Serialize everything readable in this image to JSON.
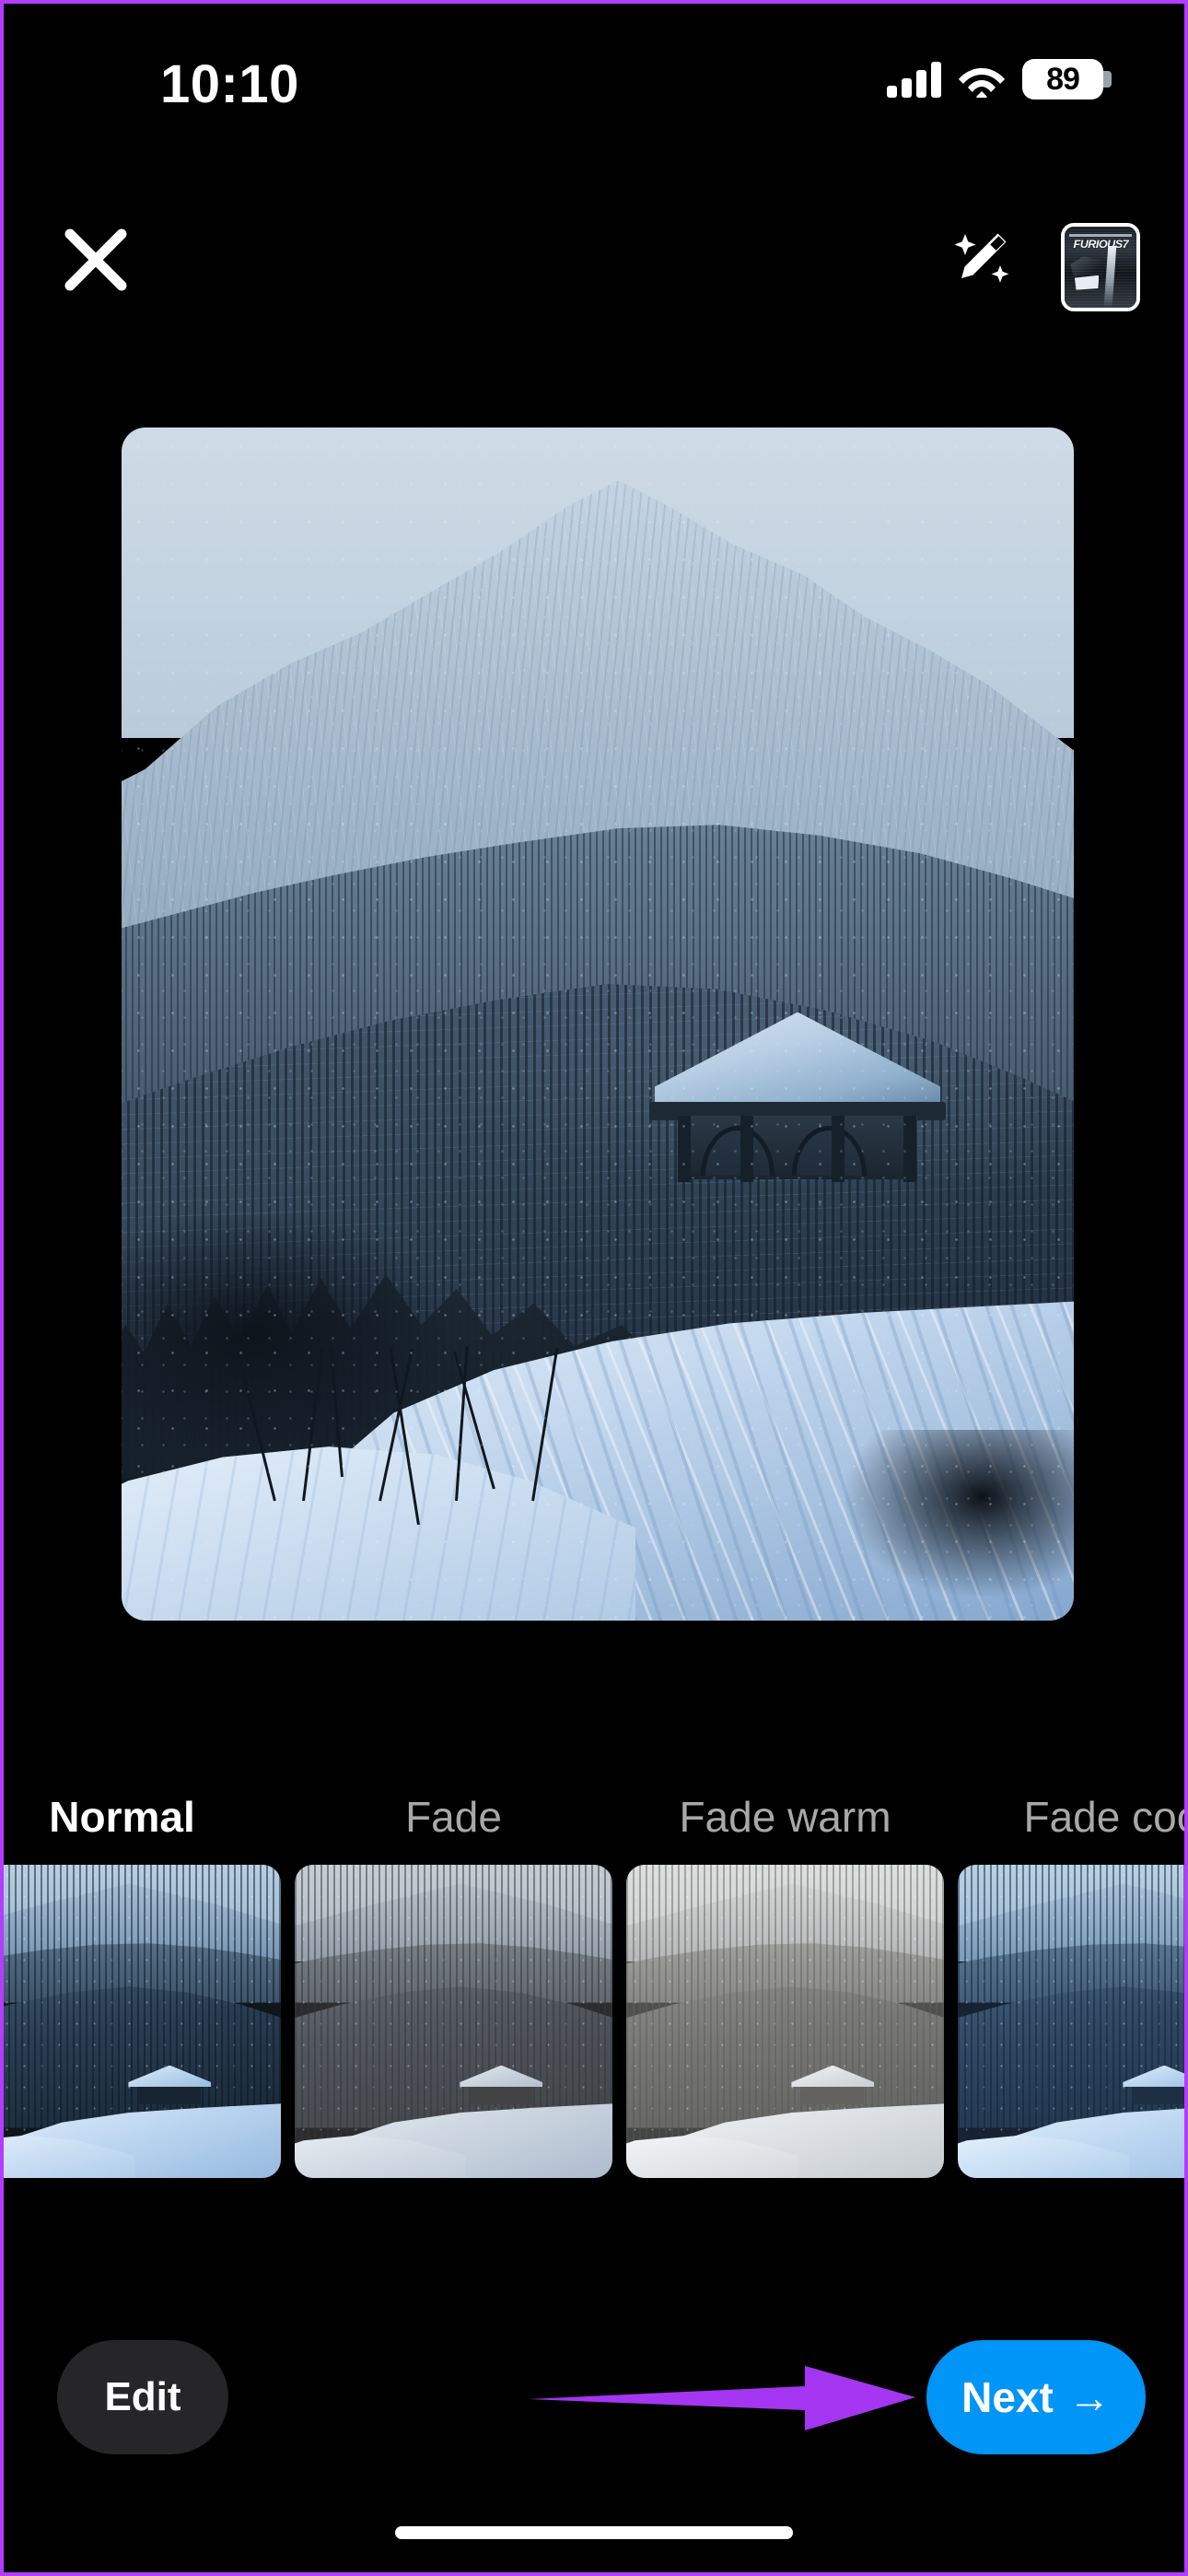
{
  "status_bar": {
    "time": "10:10",
    "signal_icon": "cellular-signal-icon",
    "wifi_icon": "wifi-icon",
    "battery_percent": "89"
  },
  "top_nav": {
    "close_icon": "close-icon",
    "magic_wand_icon": "magic-wand-icon",
    "music_thumbnail": {
      "icon": "music-cover-thumbnail",
      "title": "FURIOUS7"
    }
  },
  "main_photo": {
    "alt": "snow-covered mountain with gazebo on snowy hillside"
  },
  "filters": {
    "items": [
      {
        "label": "Normal",
        "selected": true
      },
      {
        "label": "Fade",
        "selected": false
      },
      {
        "label": "Fade warm",
        "selected": false
      },
      {
        "label": "Fade cool",
        "selected": false
      }
    ]
  },
  "bottom_bar": {
    "edit_label": "Edit",
    "next_label": "Next",
    "next_arrow": "→"
  },
  "annotations": {
    "arrow_color": "#a435f0",
    "border_color": "#b43cff"
  },
  "colors": {
    "accent_blue": "#0095F6",
    "edit_button_bg": "#262629",
    "background": "#000000"
  }
}
